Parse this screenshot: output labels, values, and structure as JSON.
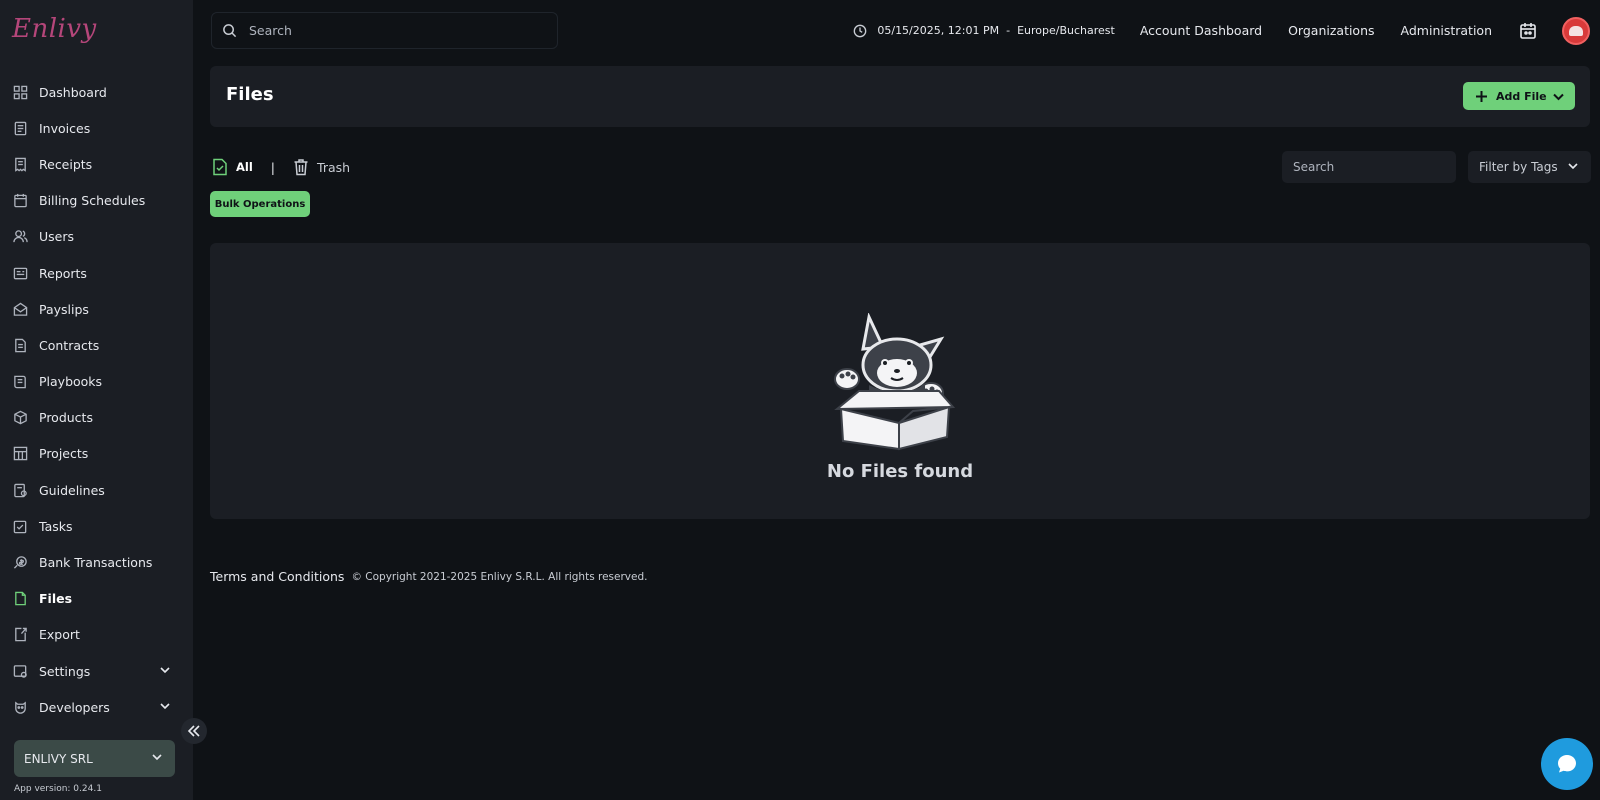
{
  "brand": {
    "logo_text": "Enlivy"
  },
  "sidebar": {
    "items": [
      {
        "label": "Dashboard",
        "icon": "dashboard-icon"
      },
      {
        "label": "Invoices",
        "icon": "invoice-icon"
      },
      {
        "label": "Receipts",
        "icon": "receipt-icon"
      },
      {
        "label": "Billing Schedules",
        "icon": "billing-schedule-icon"
      },
      {
        "label": "Users",
        "icon": "users-icon"
      },
      {
        "label": "Reports",
        "icon": "report-icon"
      },
      {
        "label": "Payslips",
        "icon": "payslip-icon"
      },
      {
        "label": "Contracts",
        "icon": "contract-icon"
      },
      {
        "label": "Playbooks",
        "icon": "playbook-icon"
      },
      {
        "label": "Products",
        "icon": "product-box-icon"
      },
      {
        "label": "Projects",
        "icon": "project-icon"
      },
      {
        "label": "Guidelines",
        "icon": "guideline-icon"
      },
      {
        "label": "Tasks",
        "icon": "task-icon"
      },
      {
        "label": "Bank Transactions",
        "icon": "bank-transaction-icon"
      },
      {
        "label": "Files",
        "icon": "file-icon",
        "active": true
      },
      {
        "label": "Export",
        "icon": "export-icon"
      },
      {
        "label": "Settings",
        "icon": "settings-icon",
        "expandable": true
      },
      {
        "label": "Developers",
        "icon": "developers-icon",
        "expandable": true
      }
    ],
    "organization": "ENLIVY SRL",
    "app_version": "App version: 0.24.1"
  },
  "topbar": {
    "search_placeholder": "Search",
    "datetime": "05/15/2025, 12:01 PM",
    "datetime_separator": "-",
    "timezone": "Europe/Bucharest",
    "links": [
      "Account Dashboard",
      "Organizations",
      "Administration"
    ]
  },
  "files_page": {
    "title": "Files",
    "add_button": "Add File",
    "tabs": {
      "all": "All",
      "divider": "|",
      "trash": "Trash"
    },
    "search_placeholder": "Search",
    "tag_filter": "Filter by Tags",
    "bulk_button": "Bulk Operations",
    "empty_message": "No Files found"
  },
  "footer": {
    "terms": "Terms and Conditions",
    "copyright": "© Copyright 2021-2025 Enlivy S.R.L. All rights reserved."
  },
  "colors": {
    "accent_green": "#6fd07a",
    "background": "#0f1216",
    "panel": "#1b1e24",
    "chat_blue": "#1f9bde",
    "logo_magenta": "#b5467a"
  }
}
